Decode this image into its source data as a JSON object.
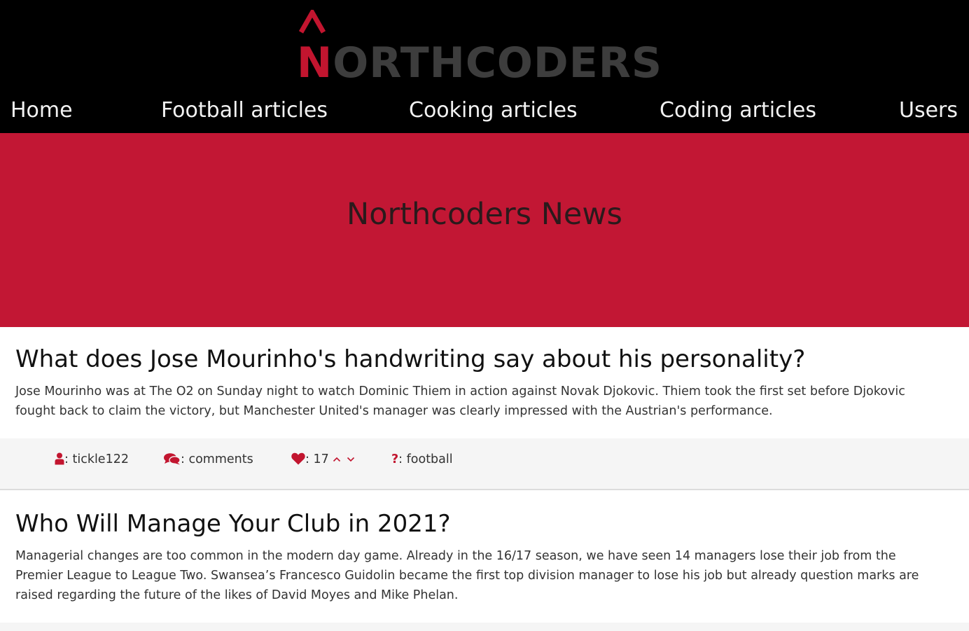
{
  "header": {
    "logo": {
      "first_letter": "N",
      "rest": "ORTHCODERS",
      "accent_color": "#c2152f",
      "text_color": "#3d3d3d",
      "caret_icon": "caret-up-icon"
    },
    "nav": [
      {
        "label": "Home"
      },
      {
        "label": "Football articles"
      },
      {
        "label": "Cooking articles"
      },
      {
        "label": "Coding articles"
      },
      {
        "label": "Users"
      }
    ]
  },
  "hero": {
    "title": "Northcoders News",
    "background": "#c21734"
  },
  "articles": [
    {
      "title": "What does Jose Mourinho's handwriting say about his personality?",
      "body": "Jose Mourinho was at The O2 on Sunday night to watch Dominic Thiem in action against Novak Djokovic. Thiem took the first set before Djokovic fought back to claim the victory, but Manchester United's manager was clearly impressed with the Austrian's performance.",
      "meta": {
        "author_prefix": ": ",
        "author": "tickle122",
        "comments_label": ": comments",
        "votes_prefix": ": ",
        "votes": "17",
        "topic_prefix": ": ",
        "topic": "football",
        "icons": [
          "user-icon",
          "comments-icon",
          "heart-icon",
          "chevron-up-icon",
          "chevron-down-icon",
          "question-icon"
        ]
      }
    },
    {
      "title": "Who Will Manage Your Club in 2021?",
      "body": "Managerial changes are too common in the modern day game. Already in the 16/17 season, we have seen 14 managers lose their job from the Premier League to League Two. Swansea’s Francesco Guidolin became the first top division manager to lose his job but already question marks are raised regarding the future of the likes of David Moyes and Mike Phelan."
    }
  ]
}
